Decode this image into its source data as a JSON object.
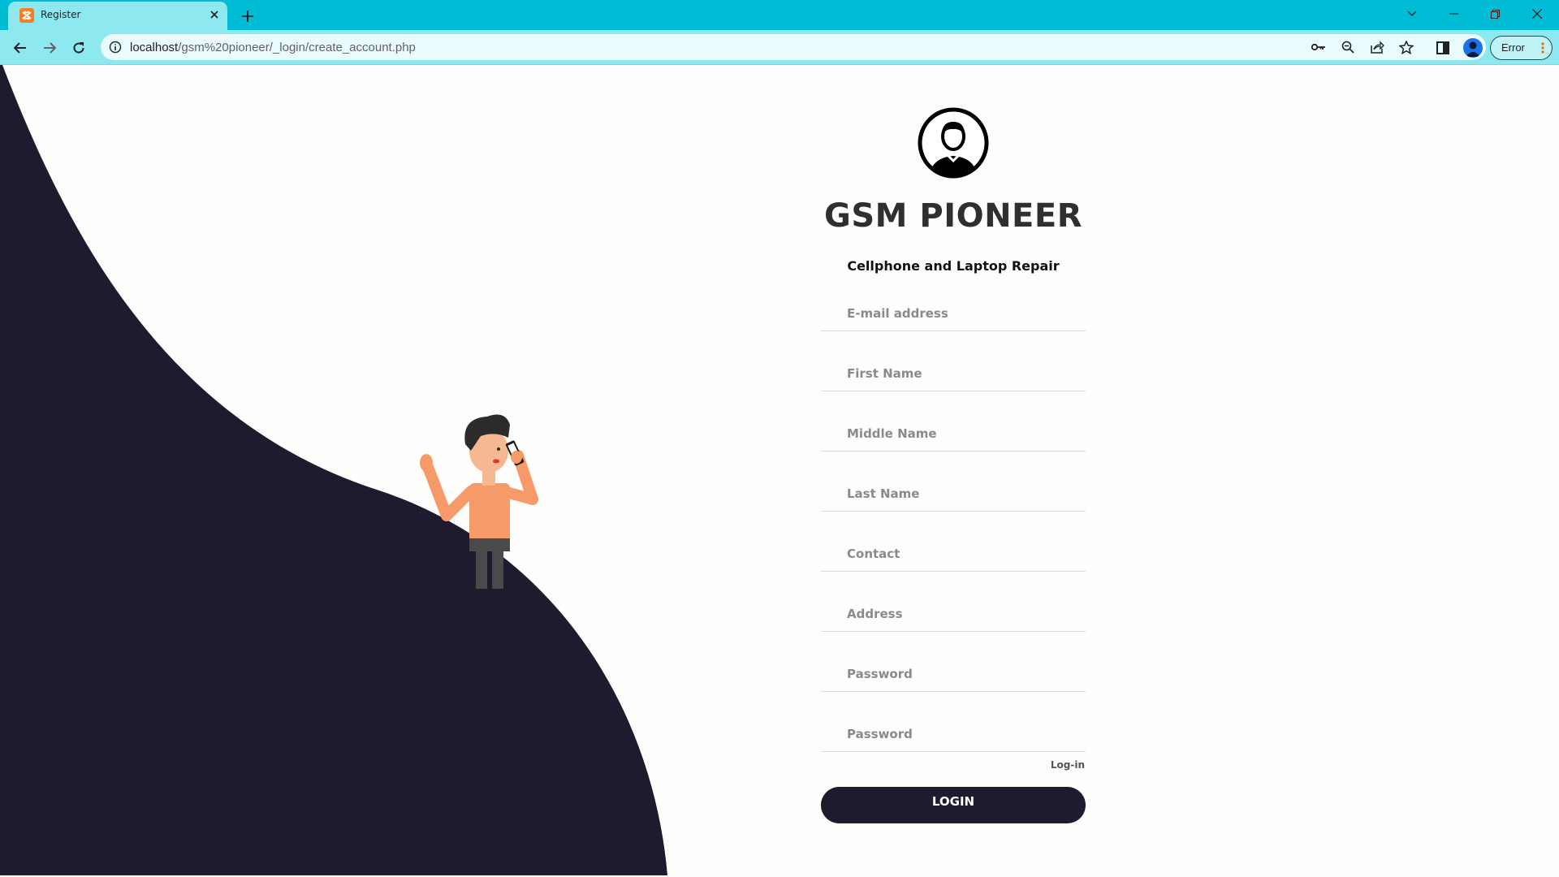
{
  "browser": {
    "tab_title": "Register",
    "url_host": "localhost",
    "url_path": "/gsm%20pioneer/_login/create_account.php",
    "profile_status": "Error",
    "accent_color": "#00bcd4"
  },
  "brand": {
    "name": "GSM PIONEER",
    "tagline": "Cellphone and Laptop Repair"
  },
  "form": {
    "email_placeholder": "E-mail address",
    "first_name_placeholder": "First Name",
    "middle_name_placeholder": "Middle Name",
    "last_name_placeholder": "Last Name",
    "contact_placeholder": "Contact",
    "address_placeholder": "Address",
    "password_placeholder": "Password",
    "confirm_password_placeholder": "Password",
    "login_link": "Log-in",
    "submit_label": "LOGIN"
  },
  "colors": {
    "dark_panel": "#201a2e",
    "button": "#201a2e"
  }
}
